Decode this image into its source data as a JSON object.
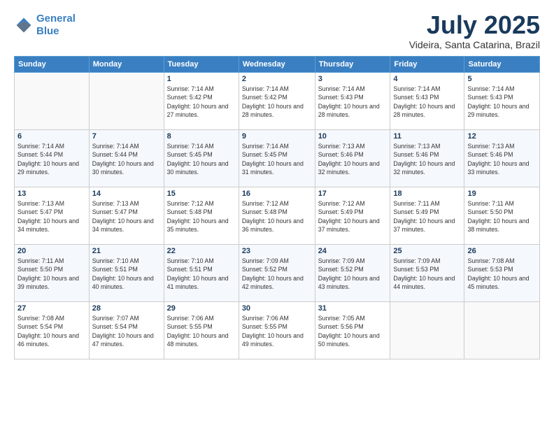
{
  "header": {
    "logo_line1": "General",
    "logo_line2": "Blue",
    "month": "July 2025",
    "location": "Videira, Santa Catarina, Brazil"
  },
  "weekdays": [
    "Sunday",
    "Monday",
    "Tuesday",
    "Wednesday",
    "Thursday",
    "Friday",
    "Saturday"
  ],
  "weeks": [
    [
      {
        "day": "",
        "info": ""
      },
      {
        "day": "",
        "info": ""
      },
      {
        "day": "1",
        "info": "Sunrise: 7:14 AM\nSunset: 5:42 PM\nDaylight: 10 hours and 27 minutes."
      },
      {
        "day": "2",
        "info": "Sunrise: 7:14 AM\nSunset: 5:42 PM\nDaylight: 10 hours and 28 minutes."
      },
      {
        "day": "3",
        "info": "Sunrise: 7:14 AM\nSunset: 5:43 PM\nDaylight: 10 hours and 28 minutes."
      },
      {
        "day": "4",
        "info": "Sunrise: 7:14 AM\nSunset: 5:43 PM\nDaylight: 10 hours and 28 minutes."
      },
      {
        "day": "5",
        "info": "Sunrise: 7:14 AM\nSunset: 5:43 PM\nDaylight: 10 hours and 29 minutes."
      }
    ],
    [
      {
        "day": "6",
        "info": "Sunrise: 7:14 AM\nSunset: 5:44 PM\nDaylight: 10 hours and 29 minutes."
      },
      {
        "day": "7",
        "info": "Sunrise: 7:14 AM\nSunset: 5:44 PM\nDaylight: 10 hours and 30 minutes."
      },
      {
        "day": "8",
        "info": "Sunrise: 7:14 AM\nSunset: 5:45 PM\nDaylight: 10 hours and 30 minutes."
      },
      {
        "day": "9",
        "info": "Sunrise: 7:14 AM\nSunset: 5:45 PM\nDaylight: 10 hours and 31 minutes."
      },
      {
        "day": "10",
        "info": "Sunrise: 7:13 AM\nSunset: 5:46 PM\nDaylight: 10 hours and 32 minutes."
      },
      {
        "day": "11",
        "info": "Sunrise: 7:13 AM\nSunset: 5:46 PM\nDaylight: 10 hours and 32 minutes."
      },
      {
        "day": "12",
        "info": "Sunrise: 7:13 AM\nSunset: 5:46 PM\nDaylight: 10 hours and 33 minutes."
      }
    ],
    [
      {
        "day": "13",
        "info": "Sunrise: 7:13 AM\nSunset: 5:47 PM\nDaylight: 10 hours and 34 minutes."
      },
      {
        "day": "14",
        "info": "Sunrise: 7:13 AM\nSunset: 5:47 PM\nDaylight: 10 hours and 34 minutes."
      },
      {
        "day": "15",
        "info": "Sunrise: 7:12 AM\nSunset: 5:48 PM\nDaylight: 10 hours and 35 minutes."
      },
      {
        "day": "16",
        "info": "Sunrise: 7:12 AM\nSunset: 5:48 PM\nDaylight: 10 hours and 36 minutes."
      },
      {
        "day": "17",
        "info": "Sunrise: 7:12 AM\nSunset: 5:49 PM\nDaylight: 10 hours and 37 minutes."
      },
      {
        "day": "18",
        "info": "Sunrise: 7:11 AM\nSunset: 5:49 PM\nDaylight: 10 hours and 37 minutes."
      },
      {
        "day": "19",
        "info": "Sunrise: 7:11 AM\nSunset: 5:50 PM\nDaylight: 10 hours and 38 minutes."
      }
    ],
    [
      {
        "day": "20",
        "info": "Sunrise: 7:11 AM\nSunset: 5:50 PM\nDaylight: 10 hours and 39 minutes."
      },
      {
        "day": "21",
        "info": "Sunrise: 7:10 AM\nSunset: 5:51 PM\nDaylight: 10 hours and 40 minutes."
      },
      {
        "day": "22",
        "info": "Sunrise: 7:10 AM\nSunset: 5:51 PM\nDaylight: 10 hours and 41 minutes."
      },
      {
        "day": "23",
        "info": "Sunrise: 7:09 AM\nSunset: 5:52 PM\nDaylight: 10 hours and 42 minutes."
      },
      {
        "day": "24",
        "info": "Sunrise: 7:09 AM\nSunset: 5:52 PM\nDaylight: 10 hours and 43 minutes."
      },
      {
        "day": "25",
        "info": "Sunrise: 7:09 AM\nSunset: 5:53 PM\nDaylight: 10 hours and 44 minutes."
      },
      {
        "day": "26",
        "info": "Sunrise: 7:08 AM\nSunset: 5:53 PM\nDaylight: 10 hours and 45 minutes."
      }
    ],
    [
      {
        "day": "27",
        "info": "Sunrise: 7:08 AM\nSunset: 5:54 PM\nDaylight: 10 hours and 46 minutes."
      },
      {
        "day": "28",
        "info": "Sunrise: 7:07 AM\nSunset: 5:54 PM\nDaylight: 10 hours and 47 minutes."
      },
      {
        "day": "29",
        "info": "Sunrise: 7:06 AM\nSunset: 5:55 PM\nDaylight: 10 hours and 48 minutes."
      },
      {
        "day": "30",
        "info": "Sunrise: 7:06 AM\nSunset: 5:55 PM\nDaylight: 10 hours and 49 minutes."
      },
      {
        "day": "31",
        "info": "Sunrise: 7:05 AM\nSunset: 5:56 PM\nDaylight: 10 hours and 50 minutes."
      },
      {
        "day": "",
        "info": ""
      },
      {
        "day": "",
        "info": ""
      }
    ]
  ]
}
